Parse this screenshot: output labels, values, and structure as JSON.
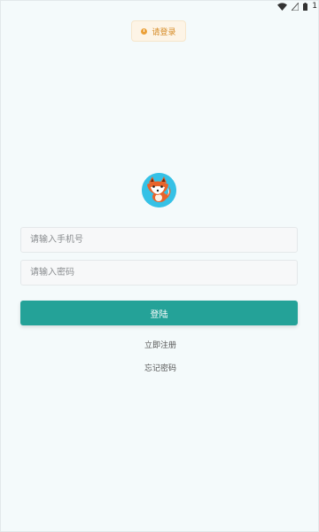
{
  "status_bar": {
    "icons": [
      "wifi-icon",
      "signal-icon",
      "battery-icon"
    ],
    "trailing_text": "1"
  },
  "toast": {
    "icon": "warning-icon",
    "text": "请登录",
    "accent_color": "#eba038"
  },
  "avatar": {
    "icon": "fox-icon",
    "background_color": "#35c1e6"
  },
  "form": {
    "phone_placeholder": "请输入手机号",
    "password_placeholder": "请输入密码",
    "phone_value": "",
    "password_value": ""
  },
  "actions": {
    "login_label": "登陆",
    "register_label": "立即注册",
    "forgot_label": "忘记密码"
  },
  "colors": {
    "primary": "#24a298",
    "page_background": "#f4fafb"
  }
}
